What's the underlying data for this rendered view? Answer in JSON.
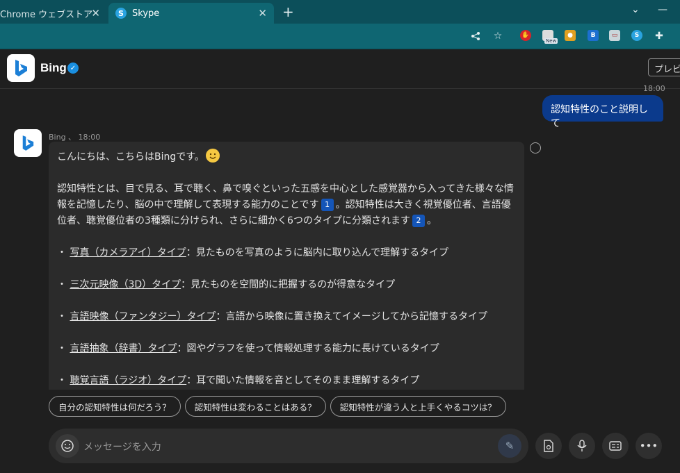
{
  "browser": {
    "tabs": [
      {
        "label": "Chrome ウェブストア",
        "close": "✕"
      },
      {
        "label": "Skype",
        "close": "✕"
      }
    ],
    "new_tab": "+",
    "minimize": "—",
    "chevron": "⌄",
    "extension_badge": "New"
  },
  "chat": {
    "name": "Bing",
    "preview_button": "プレビ",
    "user_message_time": "18:00",
    "user_message": "認知特性のこと説明して",
    "bot_meta": "Bing 、 18:00",
    "bot_message": {
      "greeting": "こんにちは、こちらはBingです。",
      "para1_a": "認知特性とは、目で見る、耳で聴く、鼻で嗅ぐといった五感を中心とした感覚器から入ってきた様々な情報を記憶したり、脳の中で理解して表現する能力のことです",
      "cite1": "1",
      "para1_b": "。認知特性は大きく視覚優位者、言語優位者、聴覚優位者の3種類に分けられ、さらに細かく6つのタイプに分類されます",
      "cite2": "2",
      "para1_c": "。",
      "bullets": [
        {
          "term": "写真（カメラアイ）タイプ",
          "desc": "：見たものを写真のように脳内に取り込んで理解するタイプ"
        },
        {
          "term": "三次元映像（3D）タイプ",
          "desc": "：見たものを空間的に把握するのが得意なタイプ"
        },
        {
          "term": "言語映像（ファンタジー）タイプ",
          "desc": "：言語から映像に置き換えてイメージしてから記憶するタイプ"
        },
        {
          "term": "言語抽象（辞書）タイプ",
          "desc": "：図やグラフを使って情報処理する能力に長けているタイプ"
        },
        {
          "term": "聴覚言語（ラジオ）タイプ",
          "desc": "：耳で聞いた情報を音としてそのまま理解するタイプ"
        }
      ]
    },
    "suggestions": [
      "自分の認知特性は何だろう？",
      "認知特性は変わることはある？",
      "認知特性が違う人と上手くやるコツは？"
    ],
    "composer_placeholder": "メッセージを入力"
  },
  "colors": {
    "tab_bar": "#0c4f5a",
    "active_tab": "#0f6672",
    "user_bubble": "#0b3a8c",
    "citation": "#1455b8",
    "background": "#1f1f1f"
  }
}
